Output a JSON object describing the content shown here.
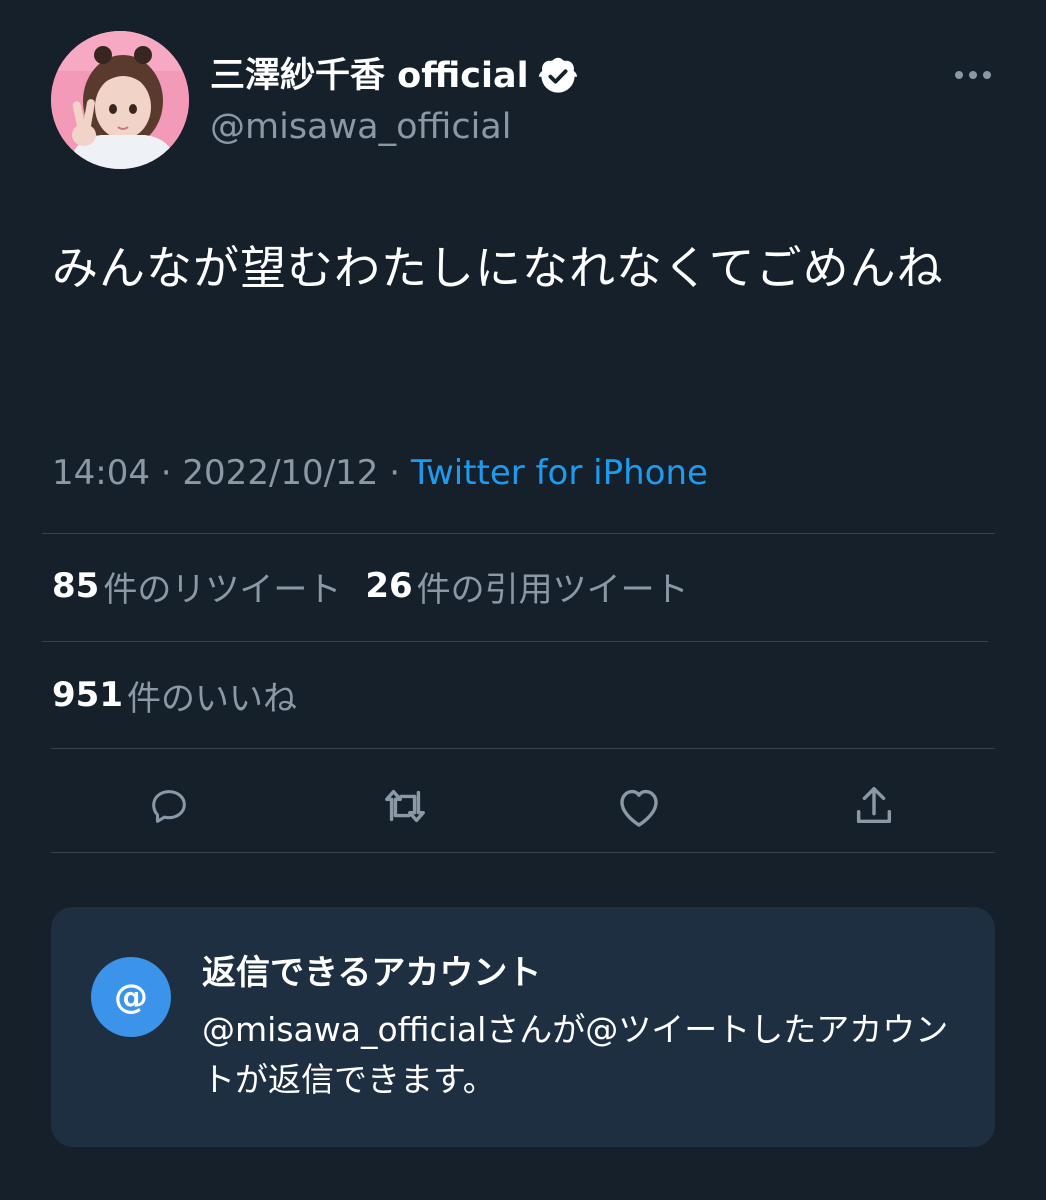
{
  "author": {
    "display_name": "三澤紗千香 official",
    "handle": "@misawa_official",
    "verified_icon": "verified-badge-icon",
    "avatar_colors": [
      "#f39ab8",
      "#eec9c2",
      "#5b3a2e"
    ]
  },
  "more_icon": "more-dots-icon",
  "tweet": {
    "text": "みんなが望むわたしになれなくてごめんね"
  },
  "meta": {
    "time": "14:04",
    "sep1": " · ",
    "date": "2022/10/12",
    "sep2": " · ",
    "source": "Twitter for iPhone"
  },
  "stats": {
    "retweets": {
      "count": "85",
      "label": "件のリツイート"
    },
    "quotes": {
      "count": "26",
      "label": "件の引用ツイート"
    },
    "likes": {
      "count": "951",
      "label": "件のいいね"
    }
  },
  "actions": [
    {
      "name": "reply",
      "icon": "reply-bubble-icon"
    },
    {
      "name": "retweet",
      "icon": "retweet-icon"
    },
    {
      "name": "like",
      "icon": "heart-icon"
    },
    {
      "name": "share",
      "icon": "share-upload-icon"
    }
  ],
  "reply_restriction": {
    "icon_glyph": "@",
    "title": "返信できるアカウント",
    "body": "@misawa_officialさんが@ツイートしたアカウントが返信できます。"
  },
  "colors": {
    "background": "#15202b",
    "text_primary": "#ffffff",
    "text_secondary": "#8b98a5",
    "accent": "#1d9bf0",
    "divider": "#38444d",
    "card_bg": "#1e2f42",
    "card_icon_bg": "#3b94e9"
  }
}
